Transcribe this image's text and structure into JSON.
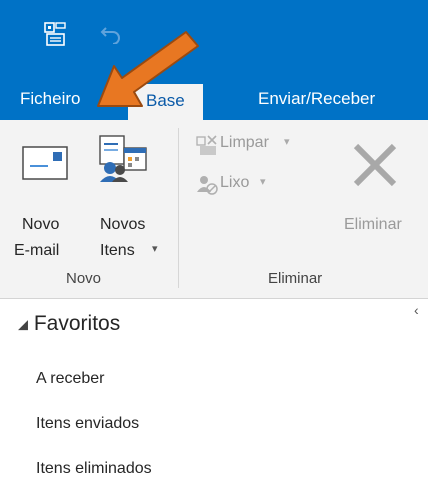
{
  "tabs": {
    "file": "Ficheiro",
    "home": "Base",
    "send_receive": "Enviar/Receber"
  },
  "ribbon": {
    "new_email_line1": "Novo",
    "new_email_line2": "E-mail",
    "new_items_line1": "Novos",
    "new_items_line2": "Itens",
    "group_new": "Novo",
    "cleanup": "Limpar",
    "junk": "Lixo",
    "delete": "Eliminar",
    "group_delete": "Eliminar"
  },
  "folders": {
    "favorites": "Favoritos",
    "items": [
      "A receber",
      "Itens enviados",
      "Itens eliminados"
    ]
  },
  "colors": {
    "titlebar": "#0072c6",
    "ribbon": "#f3f3f3",
    "annotation_arrow": "#e87722"
  }
}
